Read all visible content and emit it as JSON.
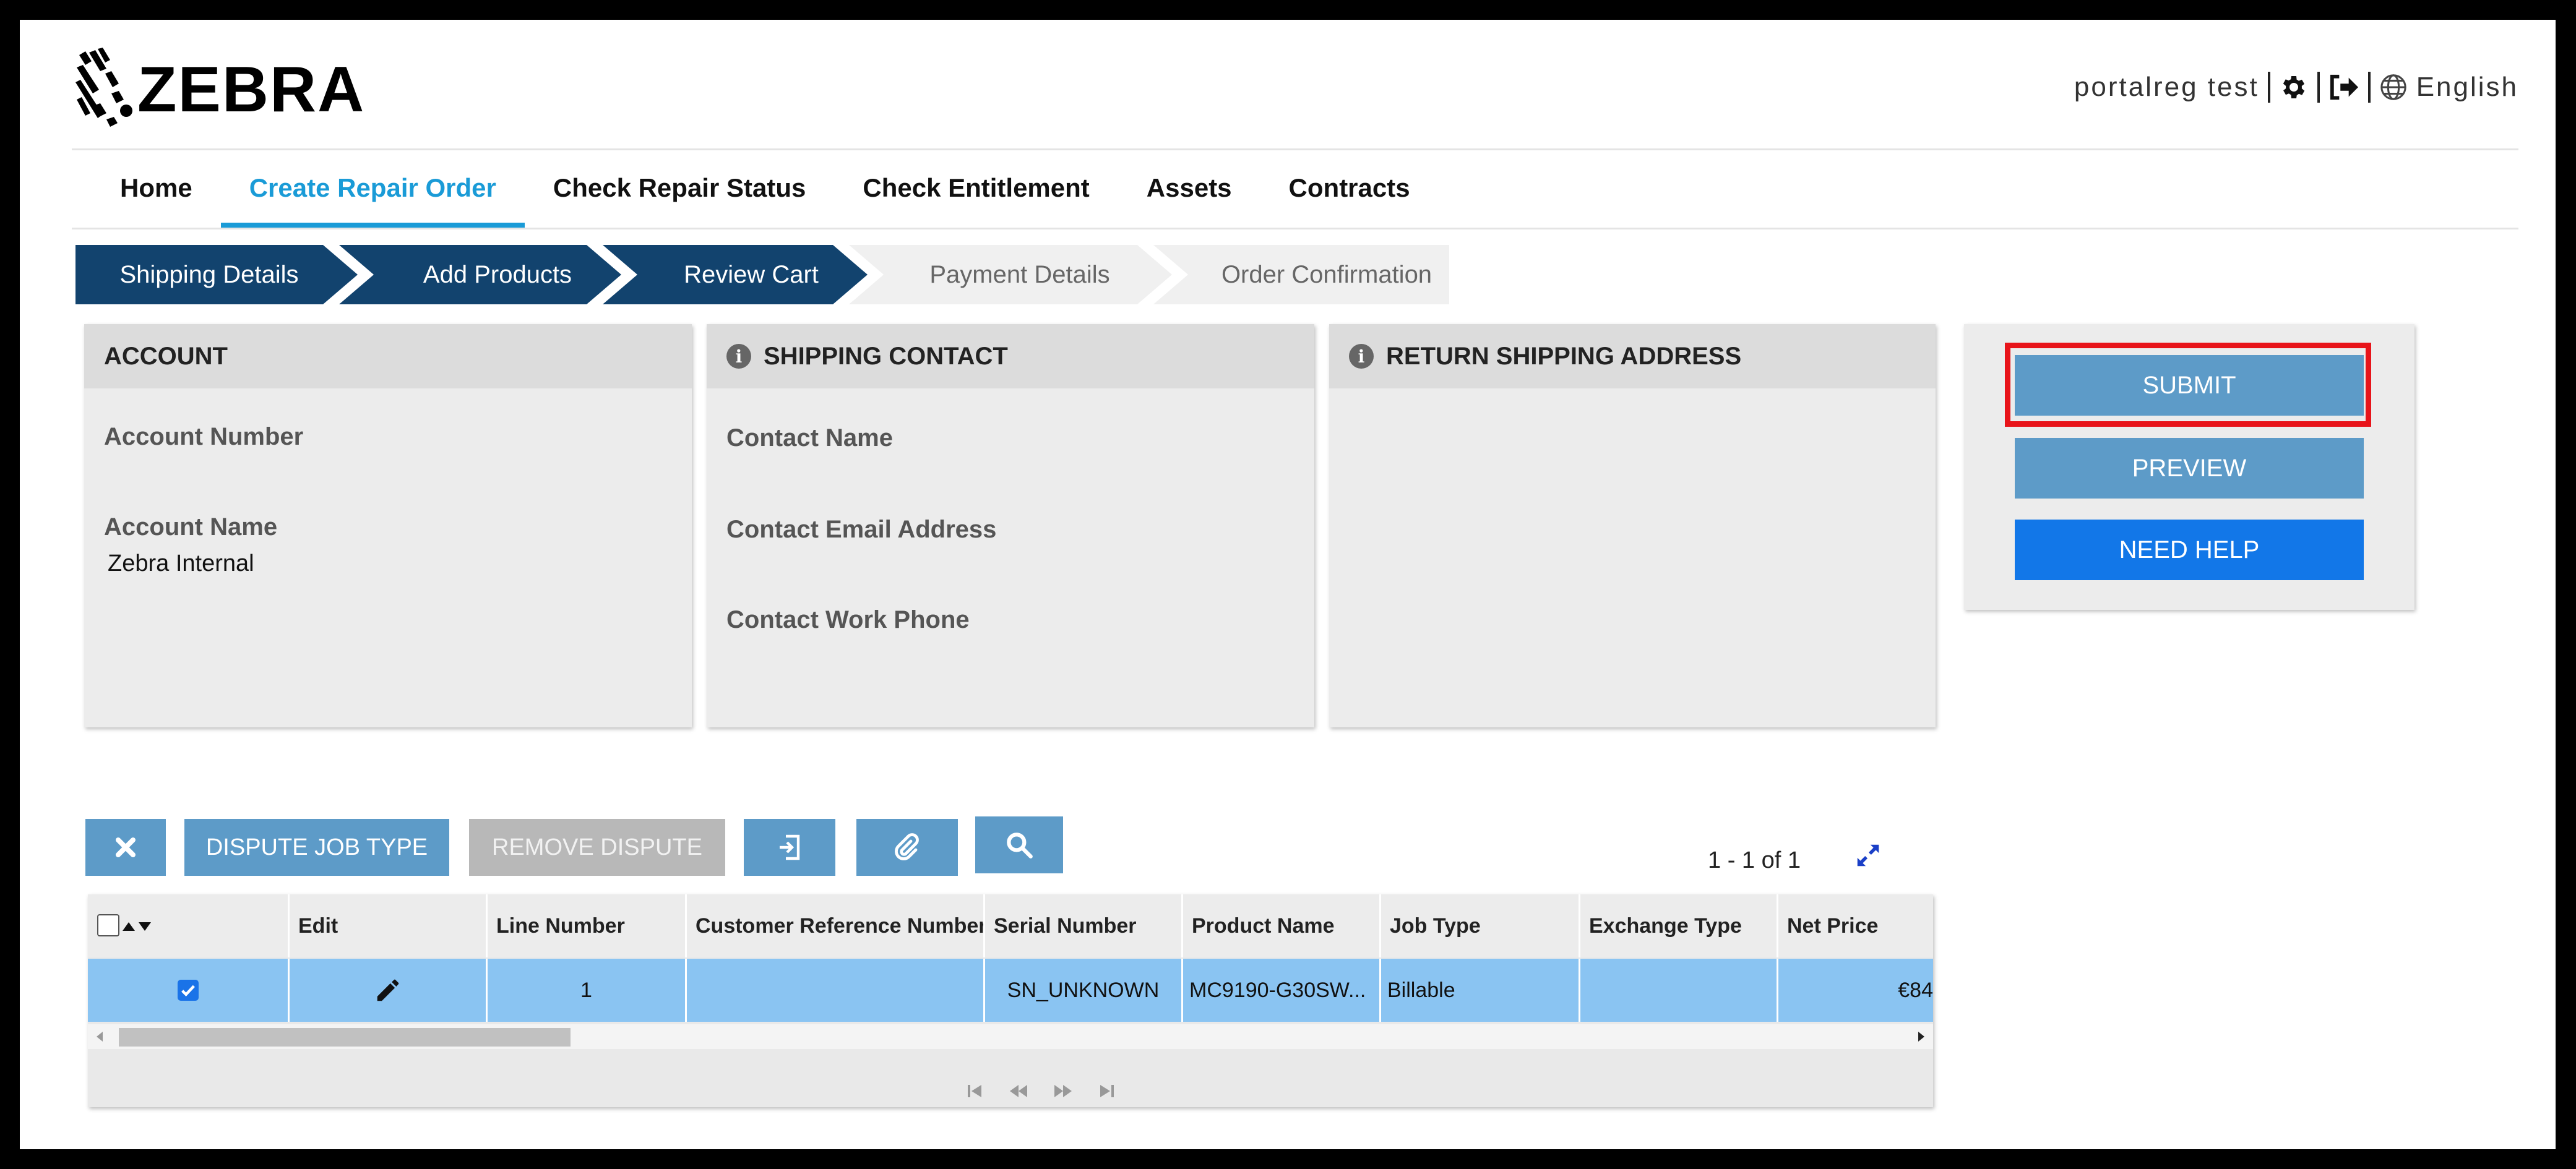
{
  "brand": {
    "logo_text": "ZEBRA"
  },
  "user_area": {
    "user": "portalreg test",
    "settings_icon": "gear-icon",
    "logout_icon": "sign-out-icon",
    "language_icon": "globe-icon",
    "language": "English"
  },
  "nav": {
    "items": [
      "Home",
      "Create Repair Order",
      "Check Repair Status",
      "Check Entitlement",
      "Assets",
      "Contracts"
    ],
    "active": "Create Repair Order"
  },
  "steps": {
    "items": [
      "Shipping Details",
      "Add Products",
      "Review Cart",
      "Payment Details",
      "Order Confirmation"
    ],
    "completed_count": 3
  },
  "account_panel": {
    "title": "ACCOUNT",
    "number_label": "Account Number",
    "number_value": "",
    "name_label": "Account Name",
    "name_value": "Zebra Internal"
  },
  "shipping_contact_panel": {
    "title": "SHIPPING CONTACT",
    "name_label": "Contact Name",
    "email_label": "Contact Email Address",
    "phone_label": "Contact Work Phone"
  },
  "return_address_panel": {
    "title": "RETURN SHIPPING ADDRESS"
  },
  "actions": {
    "submit": "SUBMIT",
    "previous": "PREVIEW",
    "need_help": "NEED HELP"
  },
  "toolbar": {
    "delete_icon": "close-icon",
    "dispute_job_type": "DISPUTE JOB TYPE",
    "remove_dispute": "REMOVE DISPUTE",
    "export_icon": "export-icon",
    "attach_icon": "paperclip-icon",
    "search_icon": "search-icon",
    "pager": "1 - 1 of 1",
    "expand_icon": "expand-icon"
  },
  "grid": {
    "columns": [
      "",
      "Edit",
      "Line Number",
      "Customer Reference Number",
      "Serial Number",
      "Product Name",
      "Job Type",
      "Exchange Type",
      "Net Price"
    ],
    "rows": [
      {
        "checked": true,
        "edit_icon": "pencil-icon",
        "line_number": "1",
        "customer_reference": "",
        "serial_number": "SN_UNKNOWN",
        "product_name": "MC9190-G30SW...",
        "job_type": "Billable",
        "exchange_type": "",
        "net_price": "€84"
      }
    ]
  },
  "colors": {
    "brand_navy": "#12436e",
    "accent": "#1a9bd7",
    "button_steel": "#5d9bc8",
    "button_blue": "#1277e8",
    "row_selected": "#8ac4f2",
    "highlight_red": "#e8141a"
  }
}
